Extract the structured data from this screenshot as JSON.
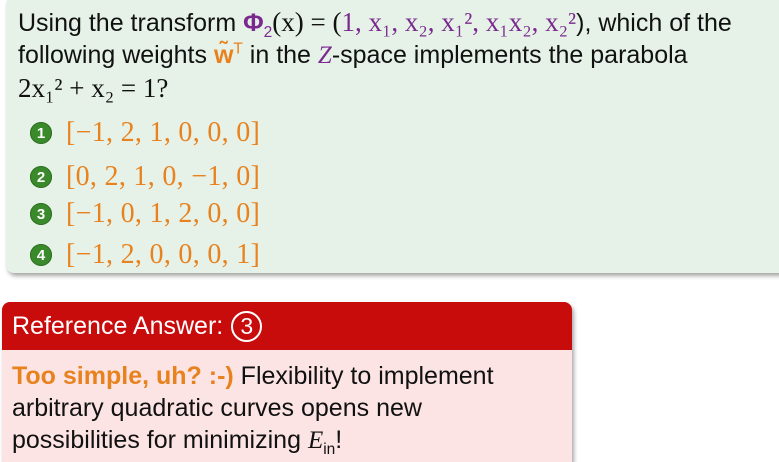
{
  "question": {
    "prefix": "Using the transform ",
    "transform_name": "Φ",
    "transform_sub": "2",
    "transform_arg": "(x)",
    "equals": " = (",
    "components": "1, x₁, x₂, x₁², x₁x₂, x₂²",
    "close": "), which of the",
    "line2_pre": "following weights ",
    "weights_symbol": "w̃",
    "weights_sup": "T",
    "line2_mid": " in the ",
    "space_symbol": "Z",
    "line2_post": "-space implements the parabola",
    "parabola": "2x₁² + x₂ = 1?"
  },
  "options": [
    {
      "number": "1",
      "text": "[−1, 2, 1, 0, 0, 0]"
    },
    {
      "number": "2",
      "text": "[0, 2, 1, 0, −1, 0]"
    },
    {
      "number": "3",
      "text": "[−1, 0, 1, 2, 0, 0]"
    },
    {
      "number": "4",
      "text": "[−1, 2, 0, 0, 0, 1]"
    }
  ],
  "answer": {
    "title": "Reference Answer:",
    "number": "3",
    "lead": "Too simple, uh? :-)",
    "line1_rest": " Flexibility to implement",
    "line2": "arbitrary quadratic curves opens new",
    "line3_pre": "possibilities for minimizing ",
    "ein": "E",
    "ein_sub": "in",
    "line3_post": "!"
  },
  "colors": {
    "question_bg": "#e6f2e7",
    "answer_header": "#c80b0b",
    "answer_bg": "#fbe4e3",
    "accent_orange": "#e8821f",
    "math_purple": "#7a2a8f",
    "option_icon_green": "#3a8a2c"
  }
}
